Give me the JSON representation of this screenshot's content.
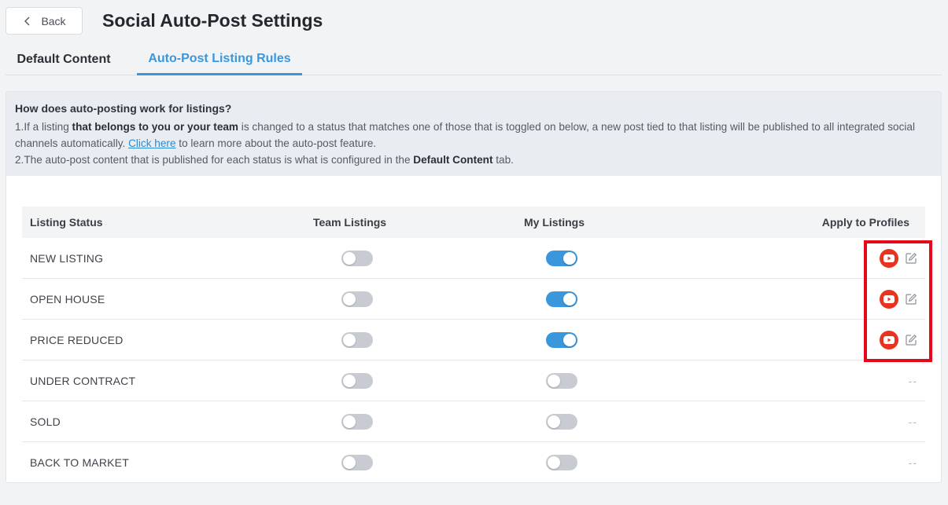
{
  "header": {
    "back_label": "Back",
    "title": "Social Auto-Post Settings"
  },
  "tabs": [
    {
      "label": "Default Content",
      "active": false
    },
    {
      "label": "Auto-Post Listing Rules",
      "active": true
    }
  ],
  "info": {
    "title": "How does auto-posting work for listings?",
    "line1_pre": "1.If a listing ",
    "line1_bold": "that belongs to you or your team",
    "line1_mid": " is changed to a status that matches one of those that is toggled on below, a new post tied to that listing will be published to all integrated social channels automatically. ",
    "line1_link": "Click here",
    "line1_post": " to learn more about the auto-post feature.",
    "line2_pre": "2.The auto-post content that is published for each status is what is configured in the ",
    "line2_bold": "Default Content",
    "line2_post": " tab."
  },
  "table": {
    "headers": {
      "status": "Listing Status",
      "team": "Team Listings",
      "mine": "My Listings",
      "apply": "Apply to Profiles"
    },
    "rows": [
      {
        "status": "NEW LISTING",
        "team_on": false,
        "mine_on": true,
        "profiles": [
          "youtube-icon"
        ],
        "empty": ""
      },
      {
        "status": "OPEN HOUSE",
        "team_on": false,
        "mine_on": true,
        "profiles": [
          "youtube-icon"
        ],
        "empty": ""
      },
      {
        "status": "PRICE REDUCED",
        "team_on": false,
        "mine_on": true,
        "profiles": [
          "youtube-icon"
        ],
        "empty": ""
      },
      {
        "status": "UNDER CONTRACT",
        "team_on": false,
        "mine_on": false,
        "profiles": [],
        "empty": "--"
      },
      {
        "status": "SOLD",
        "team_on": false,
        "mine_on": false,
        "profiles": [],
        "empty": "--"
      },
      {
        "status": "BACK TO MARKET",
        "team_on": false,
        "mine_on": false,
        "profiles": [],
        "empty": "--"
      }
    ]
  },
  "colors": {
    "accent": "#3a97dc",
    "youtube": "#e8331f",
    "highlight": "#e5081a"
  }
}
